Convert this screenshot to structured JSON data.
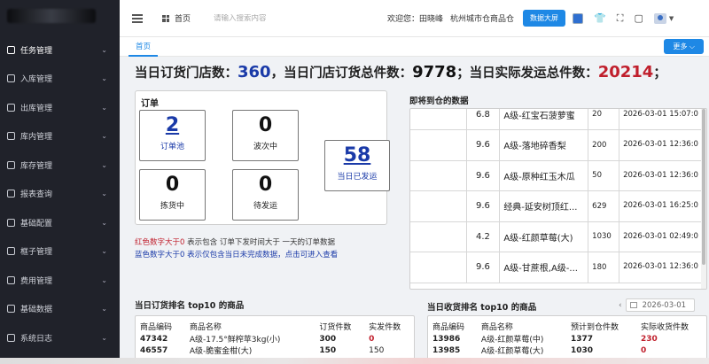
{
  "sidebar": {
    "items": [
      {
        "label": "任务管理",
        "icon": "task-icon"
      },
      {
        "label": "入库管理",
        "icon": "inbound-icon"
      },
      {
        "label": "出库管理",
        "icon": "outbound-icon"
      },
      {
        "label": "库内管理",
        "icon": "warehouse-icon"
      },
      {
        "label": "库存管理",
        "icon": "inventory-icon"
      },
      {
        "label": "报表查询",
        "icon": "report-icon"
      },
      {
        "label": "基础配置",
        "icon": "config-icon"
      },
      {
        "label": "框子管理",
        "icon": "crate-icon"
      },
      {
        "label": "费用管理",
        "icon": "fee-icon"
      },
      {
        "label": "基础数据",
        "icon": "data-icon"
      },
      {
        "label": "系统日志",
        "icon": "log-icon"
      }
    ]
  },
  "header": {
    "home_label": "首页",
    "search_placeholder": "请输入搜索内容",
    "welcome": "欢迎您：田晓峰",
    "warehouse": "杭州城市仓商品仓",
    "big_screen_label": "数据大屏",
    "accent_color": "#1e88e5"
  },
  "tabs": {
    "home": "首页",
    "more_label": "更多"
  },
  "summary": {
    "stores_prefix": "当日订货门店数：",
    "stores_value": "360",
    "orders_prefix": "，当日门店订货总件数：",
    "orders_value": "9778",
    "shipped_prefix": "；当日实际发运总件数：",
    "shipped_value": "20214",
    "suffix": "；"
  },
  "order_panel": {
    "title": "订单",
    "pool": {
      "value": "2",
      "label": "订单池"
    },
    "wave": {
      "value": "0",
      "label": "波次中"
    },
    "picking": {
      "value": "0",
      "label": "拣货中"
    },
    "pending": {
      "value": "0",
      "label": "待发运"
    },
    "shipped": {
      "value": "58",
      "label": "当日已发运"
    }
  },
  "notes": {
    "line1_red": "红色数字大于0",
    "line1_rest": " 表示包含 订单下发时间大于 一天的订单数据",
    "line2_blue": "蓝色数字大于0",
    "line2_rest": " 表示仅包含当日未完成数据，点击可进入查看"
  },
  "arrival": {
    "title": "即将到仓的数据",
    "rows": [
      {
        "score": "6.8",
        "name": "A级-红宝石菠萝蜜",
        "qty": "20",
        "time": "2026-03-01 15:07:0"
      },
      {
        "score": "9.6",
        "name": "A级-落地碎香梨",
        "qty": "200",
        "time": "2026-03-01 12:36:0"
      },
      {
        "score": "9.6",
        "name": "A级-原种红玉木瓜",
        "qty": "50",
        "time": "2026-03-01 12:36:0"
      },
      {
        "score": "9.6",
        "name": "经典-延安树顶红...",
        "qty": "629",
        "time": "2026-03-01 16:25:0"
      },
      {
        "score": "4.2",
        "name": "A级-红颜草莓(大)",
        "qty": "1030",
        "time": "2026-03-01 02:49:0"
      },
      {
        "score": "9.6",
        "name": "A级-甘蔗根,A级-...",
        "qty": "180",
        "time": "2026-03-01 12:36:0"
      }
    ]
  },
  "order_rank": {
    "title": "当日订货排名 top10 的商品",
    "headers": [
      "商品编码",
      "商品名称",
      "订货件数",
      "实发件数"
    ],
    "rows": [
      {
        "code": "47342",
        "name": "A级-17.5°鲜榨苹3kg(小)",
        "ordered": "300",
        "shipped": "0"
      },
      {
        "code": "46557",
        "name": "A级-脆蜜金柑(大)",
        "ordered": "150",
        "shipped": "150"
      }
    ]
  },
  "receive_rank": {
    "title": "当日收货排名 top10 的商品",
    "date": "2026-03-01",
    "headers": [
      "商品编码",
      "商品名称",
      "预计到仓件数",
      "实际收货件数"
    ],
    "rows": [
      {
        "code": "13986",
        "name": "A级-红颜草莓(中)",
        "expected": "1377",
        "actual": "230"
      },
      {
        "code": "13985",
        "name": "A级-红颜草莓(大)",
        "expected": "1030",
        "actual": "0"
      }
    ]
  }
}
